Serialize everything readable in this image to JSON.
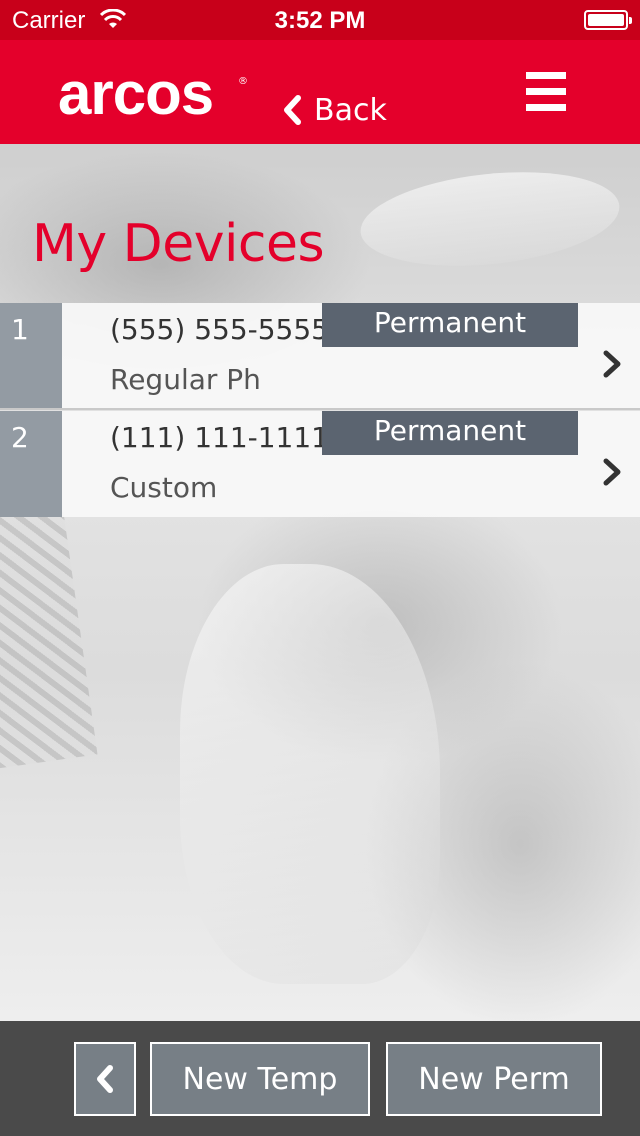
{
  "status_bar": {
    "carrier": "Carrier",
    "time": "3:52 PM"
  },
  "header": {
    "logo_text": "arcos",
    "logo_mark": "®",
    "back_label": "Back"
  },
  "page": {
    "title": "My Devices"
  },
  "devices": [
    {
      "index": "1",
      "number": "(555) 555-5555",
      "type": "Regular Ph",
      "badge": "Permanent"
    },
    {
      "index": "2",
      "number": "(111) 111-1111",
      "type": "Custom",
      "badge": "Permanent"
    }
  ],
  "footer": {
    "new_temp_label": "New Temp",
    "new_perm_label": "New Perm"
  },
  "colors": {
    "brand_red": "#e4002b",
    "status_red": "#c8001a",
    "badge_gray": "#5b6470",
    "index_gray": "#939ba3",
    "footer_bg": "#4a4a4a"
  },
  "icons": {
    "wifi": "wifi-icon",
    "battery": "battery-icon",
    "back": "chevron-left-icon",
    "menu": "hamburger-menu-icon",
    "row": "chevron-right-icon"
  }
}
